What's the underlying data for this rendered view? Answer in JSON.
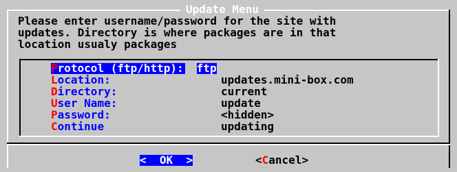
{
  "dialog": {
    "title": "Update Menu",
    "description": [
      "Please enter username/password for the site with",
      "updates. Directory is where packages are in that",
      "location usualy packages"
    ]
  },
  "menu": {
    "items": [
      {
        "hotkey": "P",
        "label": "rotocol (ftp/http):",
        "value": "ftp",
        "selected": true
      },
      {
        "hotkey": "L",
        "label": "ocation:",
        "value": "updates.mini-box.com",
        "selected": false
      },
      {
        "hotkey": "D",
        "label": "irectory:",
        "value": "current",
        "selected": false
      },
      {
        "hotkey": "U",
        "label": "ser Name:",
        "value": "update",
        "selected": false
      },
      {
        "hotkey": "P",
        "label": "assword:",
        "value": "<hidden>",
        "selected": false
      },
      {
        "hotkey": "C",
        "label": "ontinue",
        "value": "updating",
        "selected": false
      }
    ]
  },
  "buttons": {
    "ok": {
      "left": "<",
      "hotkey": "",
      "label": "  OK  ",
      "right": ">"
    },
    "cancel": {
      "left": "<",
      "hotkey": "C",
      "label": "ancel",
      "right": ">"
    }
  },
  "colors": {
    "background": "#c6c6c6",
    "title": "#ffffff",
    "accent_blue": "#0000ff",
    "hotkey_red": "#ff0000",
    "text": "#000000"
  }
}
